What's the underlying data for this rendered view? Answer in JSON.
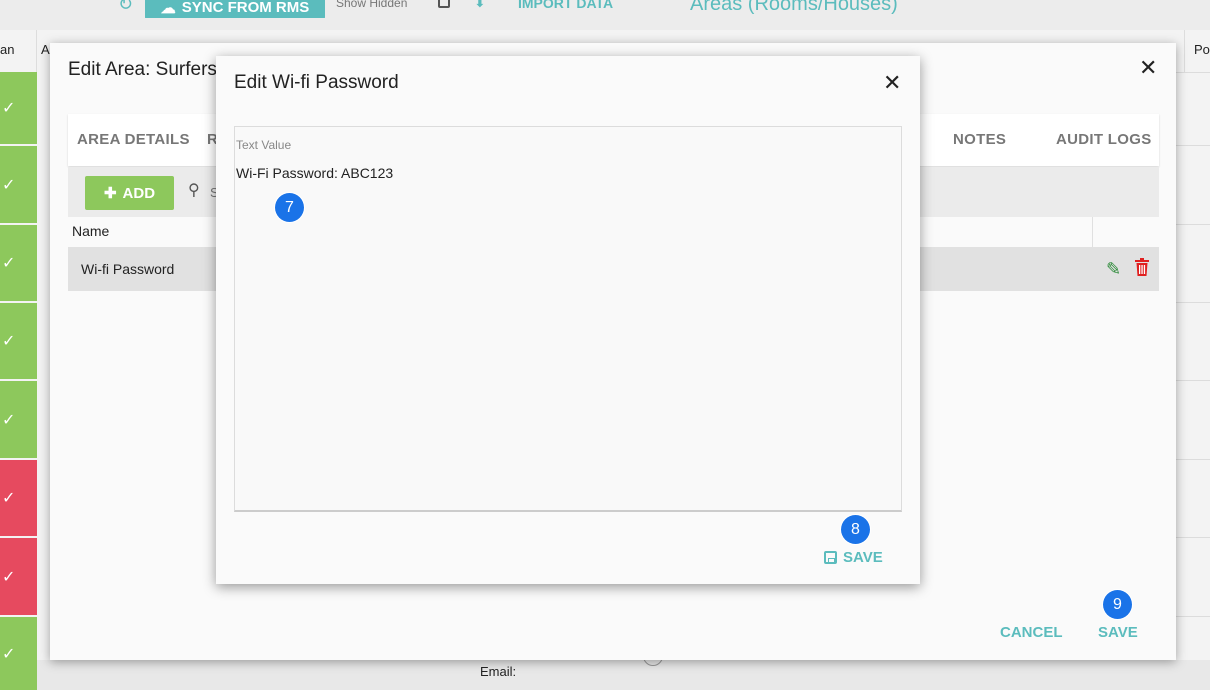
{
  "topbar": {
    "sync_label": "SYNC FROM RMS",
    "show_hidden": "Show Hidden",
    "import_label": "IMPORT DATA",
    "page_title": "Areas (Rooms/Houses)"
  },
  "background": {
    "col_left": "an",
    "col_a": "A",
    "col_po": "Po",
    "email_label": "Email:"
  },
  "area_dialog": {
    "title": "Edit Area: Surfers",
    "tabs": [
      "AREA DETAILS",
      "R",
      "NOTES",
      "AUDIT LOGS"
    ],
    "add_label": "ADD",
    "search_placeholder": "S",
    "table": {
      "header_name": "Name",
      "rows": [
        {
          "name": "Wi-fi Password"
        }
      ]
    },
    "cancel_label": "CANCEL",
    "save_label": "SAVE"
  },
  "wifi_dialog": {
    "title": "Edit Wi-fi Password",
    "field_label": "Text Value",
    "field_value": "Wi-Fi Password: ABC123",
    "save_label": "SAVE"
  },
  "badges": [
    "7",
    "8",
    "9"
  ],
  "colors": {
    "accent": "#5bbcbd",
    "add_green": "#8dc85c",
    "status_red": "#e64a5f",
    "badge_blue": "#1a73e8",
    "delete_red": "#e02020"
  }
}
